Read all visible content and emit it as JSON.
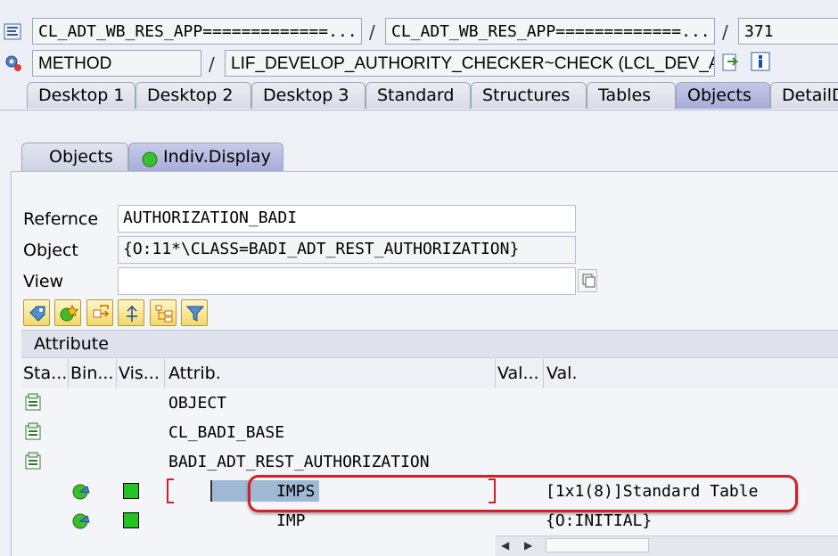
{
  "header": {
    "row1": {
      "field1": "CL_ADT_WB_RES_APP=============...",
      "sep1": "/",
      "field2": "CL_ADT_WB_RES_APP=============...",
      "sep2": "/",
      "line": "371"
    },
    "row2": {
      "type": "METHOD",
      "sep": "/",
      "method": "LIF_DEVELOP_AUTHORITY_CHECKER~CHECK (LCL_DEV_A..."
    }
  },
  "tabs": [
    {
      "label": "Desktop 1"
    },
    {
      "label": "Desktop 2"
    },
    {
      "label": "Desktop 3"
    },
    {
      "label": "Standard"
    },
    {
      "label": "Structures"
    },
    {
      "label": "Tables"
    },
    {
      "label": "Objects"
    },
    {
      "label": "DetailD"
    }
  ],
  "active_tab": "Objects",
  "subtabs": [
    {
      "label": "Objects"
    },
    {
      "label": "Indiv.Display"
    }
  ],
  "form": {
    "reference_label": "Refernce",
    "reference_value": "AUTHORIZATION_BADI",
    "object_label": "Object",
    "object_value": "{O:11*\\CLASS=BADI_ADT_REST_AUTHORIZATION}",
    "view_label": "View",
    "view_value": ""
  },
  "grid": {
    "title": "Attribute",
    "columns": [
      "Sta...",
      "Bin...",
      "Vis...",
      "Attrib.",
      "Val...",
      "Val."
    ],
    "rows": [
      {
        "status_icon": "class-structure-icon",
        "attrib": "OBJECT",
        "value": ""
      },
      {
        "status_icon": "class-structure-icon",
        "attrib": "CL_BADI_BASE",
        "value": ""
      },
      {
        "status_icon": "class-structure-icon",
        "attrib": "BADI_ADT_REST_AUTHORIZATION",
        "value": ""
      },
      {
        "binding_icon": "instance-icon",
        "visibility": "public",
        "attrib": "IMPS",
        "value": "[1x1(8)]Standard Table",
        "highlighted": true
      },
      {
        "binding_icon": "instance-icon",
        "visibility": "public",
        "attrib": "IMP",
        "value": "{O:INITIAL}"
      }
    ]
  },
  "colors": {
    "active_tab": "#a9acd9",
    "highlight": "#d0202a",
    "visible_green": "#22c322",
    "selection": "#9fb8d3"
  }
}
